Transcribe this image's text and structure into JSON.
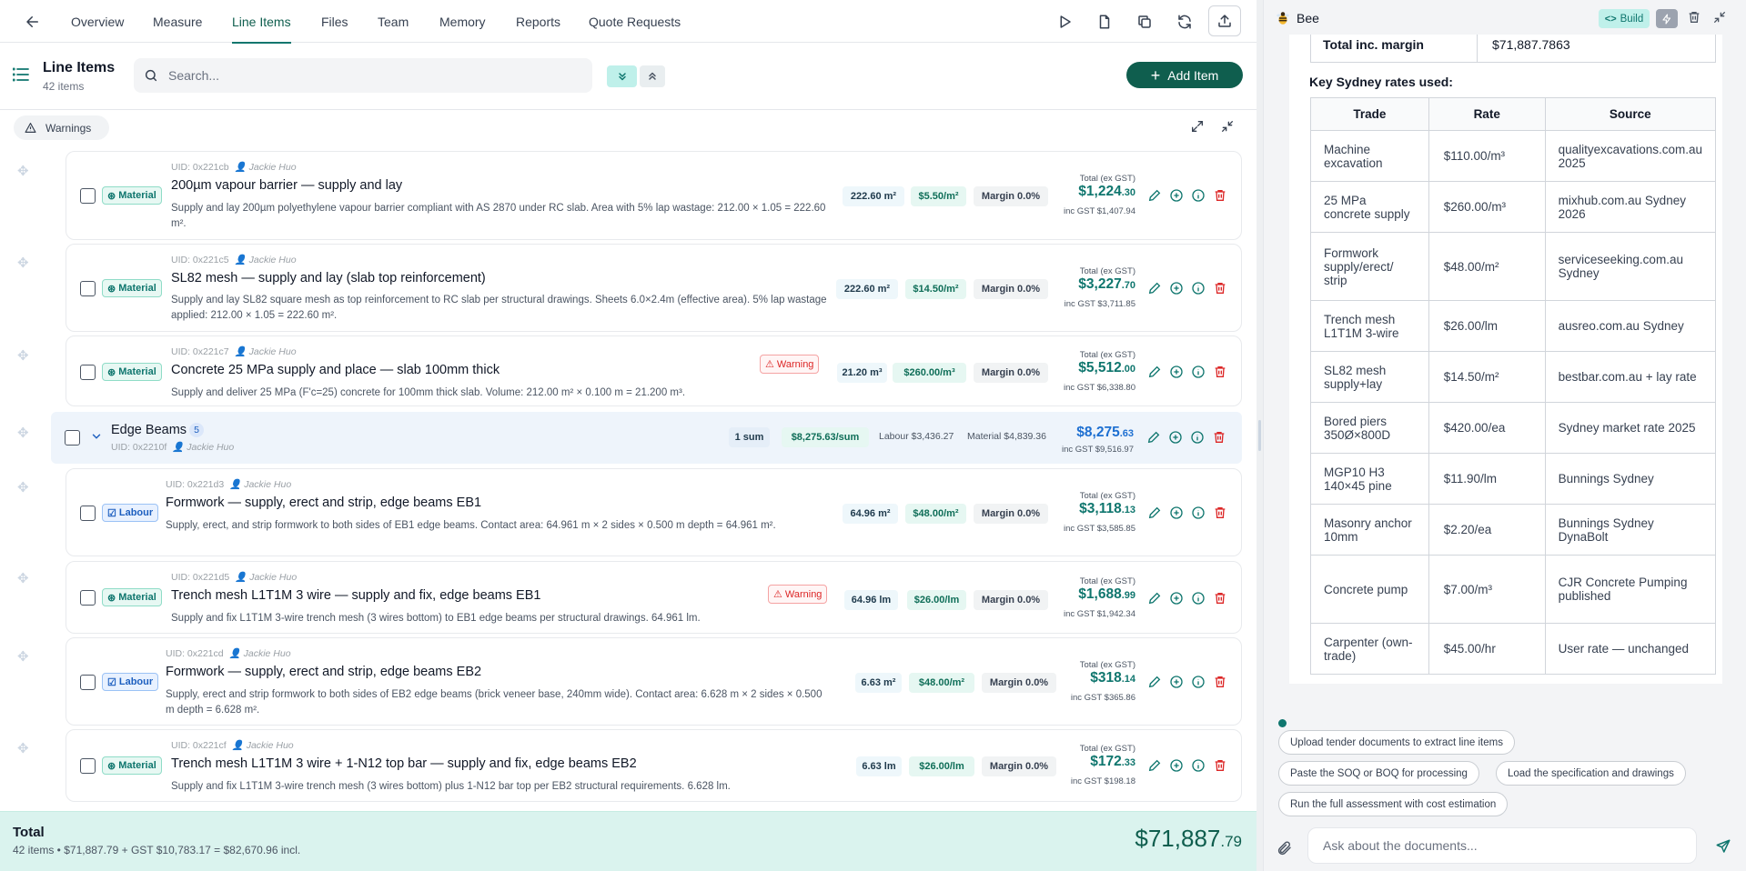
{
  "nav": {
    "tabs": [
      {
        "label": "Overview"
      },
      {
        "label": "Measure"
      },
      {
        "label": "Line Items"
      },
      {
        "label": "Files"
      },
      {
        "label": "Team"
      },
      {
        "label": "Memory"
      },
      {
        "label": "Reports"
      },
      {
        "label": "Quote Requests"
      }
    ],
    "active_tab": "Line Items"
  },
  "header": {
    "title": "Line Items",
    "count": "42 items",
    "search_placeholder": "Search...",
    "add_label": "Add Item"
  },
  "warnings_label": "Warnings",
  "items": [
    {
      "type": "Material",
      "uid": "UID: 0x221cb",
      "author": "Jackie Huo",
      "title": "200µm vapour barrier — supply and lay",
      "desc": "Supply and lay 200µm polyethylene vapour barrier compliant with AS 2870 under RC slab. Area with 5% lap wastage: 212.00 × 1.05 = 222.60 m².",
      "qty": "222.60 m²",
      "rate": "$5.50/m²",
      "margin": "Margin 0.0%",
      "warning": "",
      "total_label": "Total (ex GST)",
      "total_main": "$1,224",
      "total_cents": ".30",
      "gst": "inc GST $1,407.94"
    },
    {
      "type": "Material",
      "uid": "UID: 0x221c5",
      "author": "Jackie Huo",
      "title": "SL82 mesh — supply and lay (slab top reinforcement)",
      "desc": "Supply and lay SL82 square mesh as top reinforcement to RC slab per structural drawings. Sheets 6.0×2.4m (effective area). 5% lap wastage applied: 212.00 × 1.05 = 222.60 m².",
      "qty": "222.60 m²",
      "rate": "$14.50/m²",
      "margin": "Margin 0.0%",
      "warning": "",
      "total_label": "Total (ex GST)",
      "total_main": "$3,227",
      "total_cents": ".70",
      "gst": "inc GST $3,711.85"
    },
    {
      "type": "Material",
      "uid": "UID: 0x221c7",
      "author": "Jackie Huo",
      "title": "Concrete 25 MPa supply and place — slab 100mm thick",
      "desc": "Supply and deliver 25 MPa (F'c=25) concrete for 100mm thick slab. Volume: 212.00 m² × 0.100 m = 21.200 m³.",
      "qty": "21.20 m³",
      "rate": "$260.00/m³",
      "margin": "Margin 0.0%",
      "warning": "Warning",
      "total_label": "Total (ex GST)",
      "total_main": "$5,512",
      "total_cents": ".00",
      "gst": "inc GST $6,338.80"
    },
    {
      "type": "Labour",
      "uid": "UID: 0x221d3",
      "author": "Jackie Huo",
      "title": "Formwork — supply, erect and strip, edge beams EB1",
      "desc": "Supply, erect, and strip formwork to both sides of EB1 edge beams. Contact area: 64.961 m × 2 sides × 0.500 m depth = 64.961 m².",
      "qty": "64.96 m²",
      "rate": "$48.00/m²",
      "margin": "Margin 0.0%",
      "warning": "",
      "total_label": "Total (ex GST)",
      "total_main": "$3,118",
      "total_cents": ".13",
      "gst": "inc GST $3,585.85"
    },
    {
      "type": "Material",
      "uid": "UID: 0x221d5",
      "author": "Jackie Huo",
      "title": "Trench mesh L1T1M 3 wire — supply and fix, edge beams EB1",
      "desc": "Supply and fix L1T1M 3-wire trench mesh (3 wires bottom) to EB1 edge beams per structural drawings. 64.961 lm.",
      "qty": "64.96 lm",
      "rate": "$26.00/lm",
      "margin": "Margin 0.0%",
      "warning": "Warning",
      "total_label": "Total (ex GST)",
      "total_main": "$1,688",
      "total_cents": ".99",
      "gst": "inc GST $1,942.34"
    },
    {
      "type": "Labour",
      "uid": "UID: 0x221cd",
      "author": "Jackie Huo",
      "title": "Formwork — supply, erect and strip, edge beams EB2",
      "desc": "Supply, erect and strip formwork to both sides of EB2 edge beams (brick veneer base, 240mm wide). Contact area: 6.628 m × 2 sides × 0.500 m depth = 6.628 m².",
      "qty": "6.63 m²",
      "rate": "$48.00/m²",
      "margin": "Margin 0.0%",
      "warning": "",
      "total_label": "Total (ex GST)",
      "total_main": "$318",
      "total_cents": ".14",
      "gst": "inc GST $365.86"
    },
    {
      "type": "Material",
      "uid": "UID: 0x221cf",
      "author": "Jackie Huo",
      "title": "Trench mesh L1T1M 3 wire + 1-N12 top bar — supply and fix, edge beams EB2",
      "desc": "Supply and fix L1T1M 3-wire trench mesh (3 wires bottom) plus 1-N12 bar top per EB2 structural requirements. 6.628 lm.",
      "qty": "6.63 lm",
      "rate": "$26.00/lm",
      "margin": "Margin 0.0%",
      "warning": "",
      "total_label": "Total (ex GST)",
      "total_main": "$172",
      "total_cents": ".33",
      "gst": "inc GST $198.18"
    }
  ],
  "group": {
    "name": "Edge Beams",
    "count": "5",
    "uid": "UID: 0x2210f",
    "author": "Jackie Huo",
    "qty": "1 sum",
    "rate": "$8,275.63/sum",
    "labour": "Labour $3,436.27",
    "material": "Material $4,839.36",
    "total_main": "$8,275",
    "total_cents": ".63",
    "gst": "inc GST $9,516.97"
  },
  "footer": {
    "title": "Total",
    "summary": "42 items • $71,887.79 + GST $10,783.17 = $82,670.96 incl.",
    "total_main": "$71,887",
    "total_cents": ".79"
  },
  "assistant": {
    "name": "Bee",
    "build_label": "Build",
    "total_label": "Total inc. margin",
    "total_value": "$71,887.7863",
    "rates_heading": "Key Sydney rates used:",
    "table_headers": [
      "Trade",
      "Rate",
      "Source"
    ],
    "rates": [
      {
        "trade": "Machine excavation",
        "rate": "$110.00/m³",
        "source": "qualityexcavations.com.au 2025"
      },
      {
        "trade": "25 MPa concrete supply",
        "rate": "$260.00/m³",
        "source": "mixhub.com.au Sydney 2026"
      },
      {
        "trade": "Formwork supply/erect/ strip",
        "rate": "$48.00/m²",
        "source": "serviceseeking.com.au Sydney"
      },
      {
        "trade": "Trench mesh L1T1M 3-wire",
        "rate": "$26.00/lm",
        "source": "ausreo.com.au Sydney"
      },
      {
        "trade": "SL82 mesh supply+lay",
        "rate": "$14.50/m²",
        "source": "bestbar.com.au + lay rate"
      },
      {
        "trade": "Bored piers 350Ø×800D",
        "rate": "$420.00/ea",
        "source": "Sydney market rate 2025"
      },
      {
        "trade": "MGP10 H3 140×45 pine",
        "rate": "$11.90/lm",
        "source": "Bunnings Sydney"
      },
      {
        "trade": "Masonry anchor 10mm",
        "rate": "$2.20/ea",
        "source": "Bunnings Sydney DynaBolt"
      },
      {
        "trade": "Concrete pump",
        "rate": "$7.00/m³",
        "source": "CJR Concrete Pumping published"
      },
      {
        "trade": "Carpenter (own-trade)",
        "rate": "$45.00/hr",
        "source": "User rate — unchanged"
      }
    ],
    "suggestions": [
      "Upload tender documents to extract line items",
      "Paste the SOQ or BOQ for processing",
      "Load the specification and drawings",
      "Run the full assessment with cost estimation"
    ],
    "input_placeholder": "Ask about the documents..."
  },
  "colors": {
    "brand": "#0f5e4e",
    "accent": "#0f766e",
    "warning": "#dc2626",
    "labour": "#1d5fbf"
  }
}
